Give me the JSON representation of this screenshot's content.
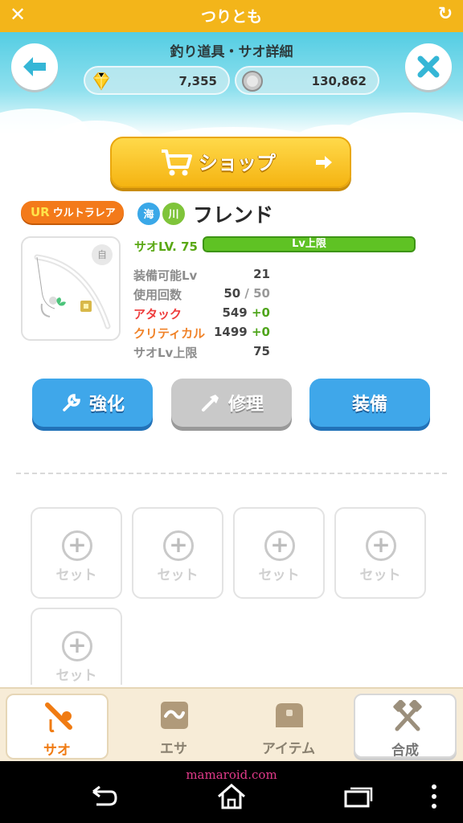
{
  "app": {
    "title": "つりとも"
  },
  "header": {
    "page_title": "釣り道具・サオ詳細",
    "gems": "7,355",
    "coins": "130,862"
  },
  "shop": {
    "label": "ショップ"
  },
  "rod": {
    "rarity_code": "UR",
    "rarity_label": "ウルトラレア",
    "tag_sea": "海",
    "tag_river": "川",
    "name": "フレンド",
    "lock_label": "自",
    "level_label": "サオLV. 75",
    "level_bar_label": "Lv上限",
    "level_fill": 1.0
  },
  "stats": {
    "equip_lv": {
      "label": "装備可能Lv",
      "value": "21"
    },
    "uses": {
      "label": "使用回数",
      "current": "50",
      "sep": " / ",
      "max": "50"
    },
    "attack": {
      "label": "アタック",
      "value": "549",
      "bonus": "+0"
    },
    "critical": {
      "label": "クリティカル",
      "value": "1499",
      "bonus": "+0"
    },
    "lv_cap": {
      "label": "サオLv上限",
      "value": "75"
    }
  },
  "actions": {
    "enhance": "強化",
    "repair": "修理",
    "equip": "装備"
  },
  "slots": [
    "セット",
    "セット",
    "セット",
    "セット",
    "セット"
  ],
  "tabs": {
    "rod": "サオ",
    "bait": "エサ",
    "items": "アイテム",
    "synth": "合成"
  },
  "watermark": "mamaroid.com",
  "colors": {
    "topbar": "#f3b51a",
    "accent_blue": "#3fa7ea",
    "level_green": "#5fc224",
    "rarity_orange": "#f37a1a"
  }
}
